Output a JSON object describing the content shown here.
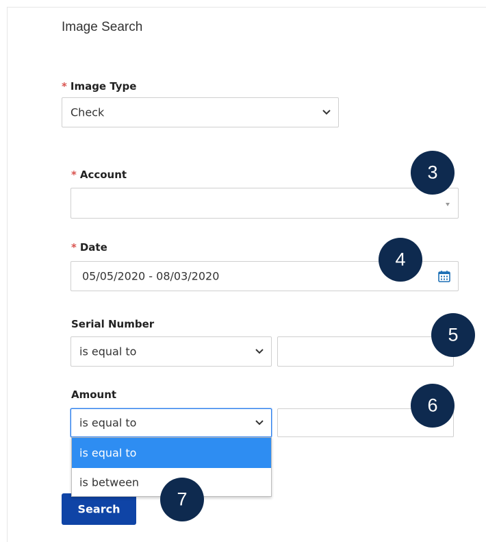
{
  "form": {
    "title": "Image Search",
    "required_marker": "*",
    "image_type": {
      "label": "Image Type",
      "value": "Check"
    },
    "account": {
      "label": "Account",
      "value": ""
    },
    "date": {
      "label": "Date",
      "value": "05/05/2020 - 08/03/2020"
    },
    "serial_number": {
      "label": "Serial Number",
      "operator": "is equal to",
      "value": ""
    },
    "amount": {
      "label": "Amount",
      "operator": "is equal to",
      "value": "",
      "options": [
        {
          "label": "is equal to",
          "selected": true
        },
        {
          "label": "is between",
          "selected": false
        }
      ]
    },
    "search_label": "Search"
  },
  "callouts": [
    "3",
    "4",
    "5",
    "6",
    "7"
  ],
  "colors": {
    "required": "#d9534f",
    "button": "#0f44a6",
    "highlight": "#2e8df2",
    "callout": "#0e2a4f",
    "icon": "#1c6fb5"
  },
  "icons": [
    "chevron-down-icon",
    "calendar-icon"
  ]
}
